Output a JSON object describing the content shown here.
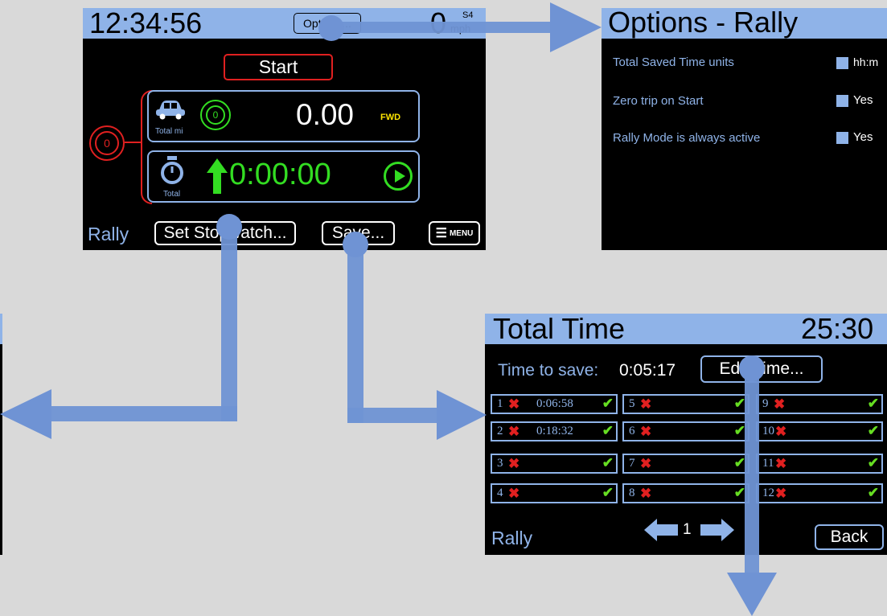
{
  "main_screen": {
    "clock": "12:34:56",
    "options_button": "Options...",
    "speed": "0",
    "speed_unit": "mph",
    "speed_tag": "S4",
    "start_button": "Start",
    "trip_value": "0.00",
    "trip_label": "Total mi",
    "trip_mode": "FWD",
    "reset_glyph": "0",
    "stopwatch_value": "0:00:00",
    "stopwatch_label": "Total",
    "mode_label": "Rally",
    "set_stopwatch_button": "Set Stopwatch...",
    "save_button": "Save...",
    "menu_button": "MENU"
  },
  "options_screen": {
    "title": "Options - Rally",
    "rows": [
      {
        "label": "Total Saved Time units",
        "value": "hh:m"
      },
      {
        "label": "Zero trip on Start",
        "value": "Yes"
      },
      {
        "label": "Rally Mode is always active",
        "value": "Yes"
      }
    ]
  },
  "total_time_screen": {
    "title": "Total Time",
    "clock": "25:30",
    "time_to_save_label": "Time to save:",
    "time_to_save_value": "0:05:17",
    "edit_time_button": "Edit Time...",
    "slots": [
      {
        "n": "1",
        "time": "0:06:58"
      },
      {
        "n": "2",
        "time": "0:18:32"
      },
      {
        "n": "3",
        "time": ""
      },
      {
        "n": "4",
        "time": ""
      },
      {
        "n": "5",
        "time": ""
      },
      {
        "n": "6",
        "time": ""
      },
      {
        "n": "7",
        "time": ""
      },
      {
        "n": "8",
        "time": ""
      },
      {
        "n": "9",
        "time": ""
      },
      {
        "n": "10",
        "time": ""
      },
      {
        "n": "11",
        "time": ""
      },
      {
        "n": "12",
        "time": ""
      }
    ],
    "page_number": "1",
    "mode_label": "Rally",
    "back_button": "Back"
  },
  "colors": {
    "background": "#d9d9d9",
    "title_bar": "#8fb3e8",
    "flow_arrow": "#6f93d4",
    "active_green": "#33dd22",
    "alert_red": "#e02020"
  }
}
